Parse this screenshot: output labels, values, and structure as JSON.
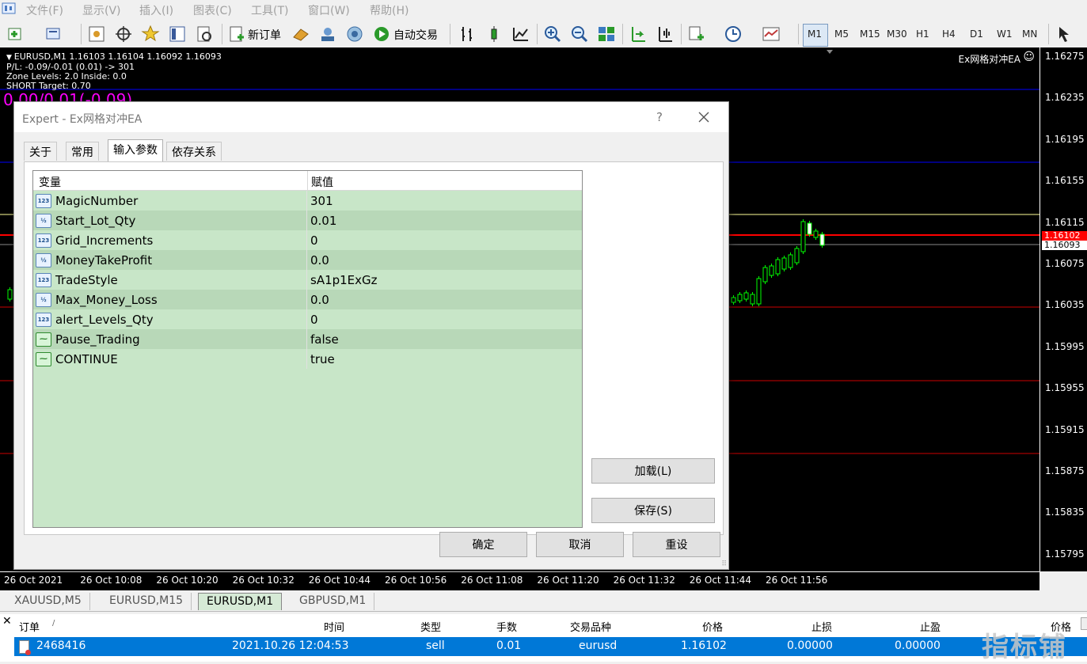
{
  "menu": [
    "文件(F)",
    "显示(V)",
    "插入(I)",
    "图表(C)",
    "工具(T)",
    "窗口(W)",
    "帮助(H)"
  ],
  "toolbar": {
    "new_order": "新订单",
    "auto_trade": "自动交易",
    "timeframes": [
      "M1",
      "M5",
      "M15",
      "M30",
      "H1",
      "H4",
      "D1",
      "W1",
      "MN"
    ]
  },
  "chart": {
    "header": "EURUSD,M1  1.16103 1.16104 1.16092 1.16093",
    "pl": "P/L: -0.09/-0.01 (0.01) -> 301",
    "zone": "Zone Levels: 2.0 Inside: 0.0",
    "short_target": "SHORT Target: 0.70",
    "big_pl": "0.00/0.01(-0.09)",
    "ea_label": "Ex网格对冲EA",
    "prices": [
      "1.16275",
      "1.16235",
      "1.16195",
      "1.16155",
      "1.16115",
      "1.16075",
      "1.16035",
      "1.15995",
      "1.15955",
      "1.15915",
      "1.15875",
      "1.15835",
      "1.15795"
    ],
    "bid_tag": "1.16102",
    "ask_tag": "1.16093",
    "times": [
      "26 Oct 2021",
      "26 Oct 10:08",
      "26 Oct 10:20",
      "26 Oct 10:32",
      "26 Oct 10:44",
      "26 Oct 10:56",
      "26 Oct 11:08",
      "26 Oct 11:20",
      "26 Oct 11:32",
      "26 Oct 11:44",
      "26 Oct 11:56"
    ],
    "colors": {
      "blue_line": "#0000ff",
      "red_line": "#ff0000",
      "yellow_line": "#ffff99",
      "candle": "#00ff00"
    }
  },
  "dialog": {
    "title": "Expert - Ex网格对冲EA",
    "help": "?",
    "tabs": [
      "关于",
      "常用",
      "输入参数",
      "依存关系"
    ],
    "col_var": "变量",
    "col_val": "赋值",
    "params": [
      {
        "icon": "123",
        "name": "MagicNumber",
        "value": "301"
      },
      {
        "icon": "V2",
        "name": "Start_Lot_Qty",
        "value": "0.01"
      },
      {
        "icon": "123",
        "name": "Grid_Increments",
        "value": "0"
      },
      {
        "icon": "V2",
        "name": "MoneyTakeProfit",
        "value": "0.0"
      },
      {
        "icon": "123",
        "name": "TradeStyle",
        "value": "sA1p1ExGz"
      },
      {
        "icon": "V2",
        "name": "Max_Money_Loss",
        "value": "0.0"
      },
      {
        "icon": "123",
        "name": "alert_Levels_Qty",
        "value": "0"
      },
      {
        "icon": "bool",
        "name": "Pause_Trading",
        "value": "false"
      },
      {
        "icon": "bool",
        "name": "CONTINUE",
        "value": "true"
      }
    ],
    "load": "加载(L)",
    "save": "保存(S)",
    "ok": "确定",
    "cancel": "取消",
    "reset": "重设"
  },
  "symbol_tabs": [
    "XAUUSD,M5",
    "EURUSD,M15",
    "EURUSD,M1",
    "GBPUSD,M1"
  ],
  "terminal": {
    "headers": [
      "订单",
      "时间",
      "类型",
      "手数",
      "交易品种",
      "价格",
      "止损",
      "止盈",
      "价格"
    ],
    "order": {
      "id": "2468416",
      "time": "2021.10.26 12:04:53",
      "type": "sell",
      "lots": "0.01",
      "symbol": "eurusd",
      "price": "1.16102",
      "sl": "0.00000",
      "tp": "0.00000"
    }
  },
  "watermark": "指标铺"
}
